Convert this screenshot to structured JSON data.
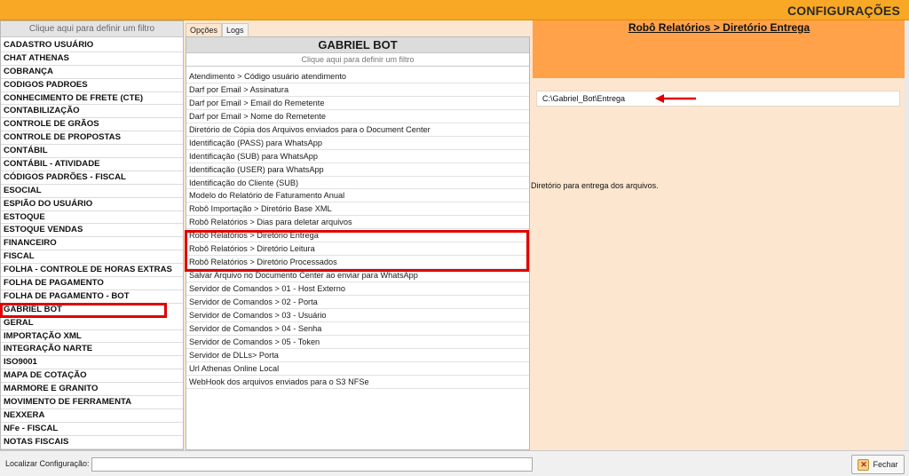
{
  "window": {
    "title": "CONFIGURAÇÕES"
  },
  "left_panel": {
    "filter_hint": "Clique aqui para definir um filtro",
    "items": [
      "CADASTRO USUÁRIO",
      "CHAT ATHENAS",
      "COBRANÇA",
      "CODIGOS PADROES",
      "CONHECIMENTO DE FRETE (CTE)",
      "CONTABILIZAÇÃO",
      "CONTROLE DE GRÃOS",
      "CONTROLE DE PROPOSTAS",
      "CONTÁBIL",
      "CONTÁBIL - ATIVIDADE",
      "CÓDIGOS PADRÕES - FISCAL",
      "ESOCIAL",
      "ESPIÃO DO USUÁRIO",
      "ESTOQUE",
      "ESTOQUE VENDAS",
      "FINANCEIRO",
      "FISCAL",
      "FOLHA - CONTROLE DE HORAS EXTRAS",
      "FOLHA DE PAGAMENTO",
      "FOLHA DE PAGAMENTO - BOT",
      "GABRIEL BOT",
      "GERAL",
      "IMPORTAÇÃO XML",
      "INTEGRAÇÃO NARTE",
      "ISO9001",
      "MAPA DE COTAÇÃO",
      "MARMORE E GRANITO",
      "MOVIMENTO DE FERRAMENTA",
      "NEXXERA",
      "NFe - FISCAL",
      "NOTAS FISCAIS"
    ],
    "selected": "GABRIEL BOT"
  },
  "tabs": [
    {
      "label": "Opções",
      "active": true
    },
    {
      "label": "Logs",
      "active": false
    }
  ],
  "middle_panel": {
    "header": "GABRIEL BOT",
    "filter_hint": "Clique aqui para definir um filtro",
    "items": [
      "Atendimento > Código usuário atendimento",
      "Darf por Email > Assinatura",
      "Darf por Email > Email do Remetente",
      "Darf por Email > Nome do Remetente",
      "Diretório de Cópia dos Arquivos enviados para o Document Center",
      "Identificação (PASS) para WhatsApp",
      "Identificação (SUB) para WhatsApp",
      "Identificação (USER) para WhatsApp",
      "Identificação do Cliente (SUB)",
      "Modelo do Relatório de Faturamento Anual",
      "Robô Importação > Diretório Base XML",
      "Robô Relatórios > Dias para deletar arquivos",
      "Robô Relatórios > Diretório Entrega",
      "Robô Relatórios > Diretório Leitura",
      "Robô Relatórios > Diretório Processados",
      "Salvar Arquivo no Documento Center ao enviar para WhatsApp",
      "Servidor de Comandos > 01 - Host Externo",
      "Servidor de Comandos > 02 - Porta",
      "Servidor de Comandos > 03 - Usuário",
      "Servidor de Comandos > 04 - Senha",
      "Servidor de Comandos > 05 - Token",
      "Servidor de DLLs> Porta",
      "Url Athenas Online Local",
      "WebHook dos arquivos enviados para o S3 NFSe"
    ]
  },
  "detail_panel": {
    "title": "Robô Relatórios > Diretório Entrega",
    "value": "C:\\Gabriel_Bot\\Entrega",
    "description": "Diretório para entrega dos arquivos.",
    "arrow_icon": "red-arrow-left-icon"
  },
  "bottom_bar": {
    "search_label": "Localizar Configuração:",
    "search_value": "",
    "close_label": "Fechar",
    "close_icon": "close-icon"
  },
  "colors": {
    "titlebar": "#f9a825",
    "detail_header": "#ffa24a",
    "panel_bg": "#fde6cf",
    "highlight": "#e00000"
  }
}
